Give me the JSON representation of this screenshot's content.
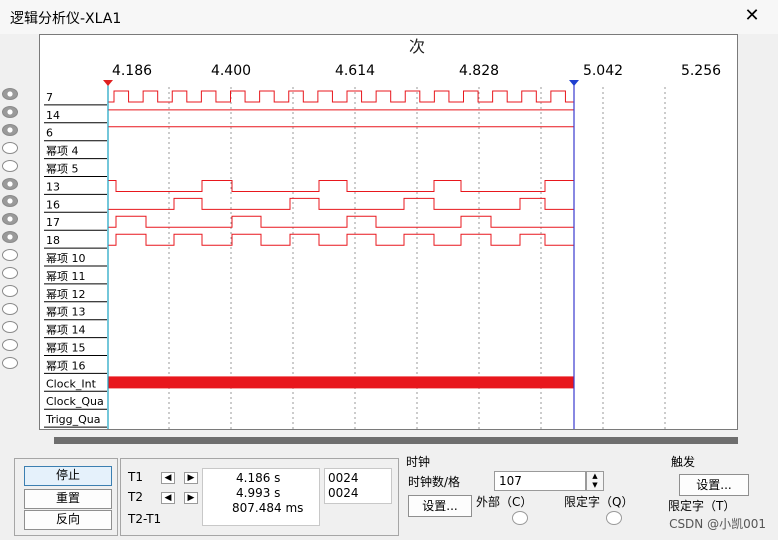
{
  "window": {
    "title": "逻辑分析仪-XLA1",
    "close_icon": "close-icon"
  },
  "plot": {
    "unit_label": "次",
    "time_ticks": [
      "4.186",
      "4.400",
      "4.614",
      "4.828",
      "5.042",
      "5.256"
    ],
    "channels": [
      "7",
      "14",
      "6",
      "幂项 4",
      "幂项 5",
      "13",
      "16",
      "17",
      "18",
      "幂项 10",
      "幂项 11",
      "幂项 12",
      "幂项 13",
      "幂项 14",
      "幂项 15",
      "幂项 16"
    ],
    "channel_connected": [
      true,
      true,
      true,
      false,
      false,
      true,
      true,
      true,
      true,
      false,
      false,
      false,
      false,
      false,
      false,
      false
    ],
    "extra_rows": [
      "Clock_Int",
      "Clock_Qua",
      "Trigg_Qua"
    ],
    "signal_color": "#e8171d",
    "t1_color": "#17a2c2",
    "t2_color": "#3a3acf"
  },
  "controls": {
    "stop": "停止",
    "reset": "重置",
    "reverse": "反向"
  },
  "cursors": {
    "t1_label": "T1",
    "t2_label": "T2",
    "dt_label": "T2-T1",
    "t1_value": "4.186 s",
    "t2_value": "4.993 s",
    "dt_value": "807.484 ms",
    "t1_code": "0024",
    "t2_code": "0024"
  },
  "clock": {
    "title": "时钟",
    "per_div_label": "时钟数/格",
    "per_div_value": "107",
    "setup": "设置...",
    "external": "外部（C）",
    "qualifier": "限定字（Q）"
  },
  "trigger": {
    "title": "触发",
    "setup": "设置...",
    "qualifier": "限定字（T）"
  },
  "watermark": "CSDN @小凯001"
}
